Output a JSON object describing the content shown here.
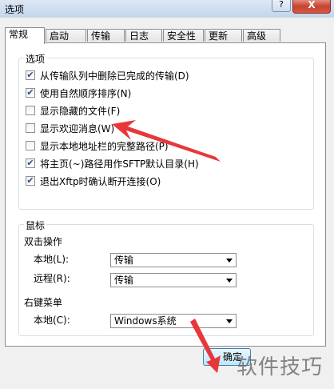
{
  "window": {
    "title": "选项",
    "help_label": "?",
    "close_label": "X"
  },
  "tabs": [
    {
      "label": "常规"
    },
    {
      "label": "启动"
    },
    {
      "label": "传输"
    },
    {
      "label": "日志"
    },
    {
      "label": "安全性"
    },
    {
      "label": "更新"
    },
    {
      "label": "高级"
    }
  ],
  "options": {
    "legend": "选项",
    "items": [
      {
        "label": "从传输队列中删除已完成的传输(D)",
        "checked": true
      },
      {
        "label": "使用自然顺序排序(N)",
        "checked": true
      },
      {
        "label": "显示隐藏的文件(F)",
        "checked": false
      },
      {
        "label": "显示欢迎消息(W)",
        "checked": false
      },
      {
        "label": "显示本地地址栏的完整路径(P)",
        "checked": false
      },
      {
        "label": "将主页(~)路径用作SFTP默认目录(H)",
        "checked": true
      },
      {
        "label": "退出Xftp时确认断开连接(O)",
        "checked": true
      }
    ]
  },
  "mouse": {
    "legend": "鼠标",
    "dblclick_title": "双击操作",
    "local_label": "本地(L):",
    "local_value": "传输",
    "remote_label": "远程(R):",
    "remote_value": "传输",
    "context_title": "右键菜单",
    "context_local_label": "本地(C):",
    "context_local_value": "Windows系统"
  },
  "buttons": {
    "ok_label": "确定"
  },
  "watermark": "软件技巧",
  "colors": {
    "annotation_arrow": "#e8373a"
  }
}
